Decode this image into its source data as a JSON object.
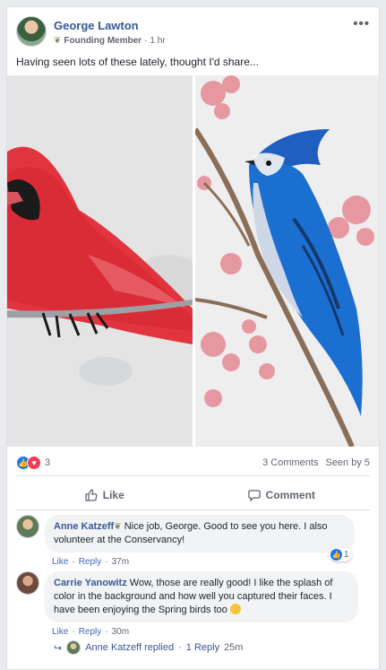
{
  "post": {
    "author": "George Lawton",
    "badge": "Founding Member",
    "time": "1 hr",
    "separator": "·",
    "text": "Having seen lots of these lately, thought I'd share...",
    "more_icon": "•••"
  },
  "reactions": {
    "count": "3",
    "comments": "3 Comments",
    "seen": "Seen by 5"
  },
  "actions": {
    "like_label": "Like",
    "comment_label": "Comment"
  },
  "comments": [
    {
      "name": "Anne Katzeff",
      "text": "Nice job, George. Good to see you here. I also volunteer at the Conservancy!",
      "like": "Like",
      "reply": "Reply",
      "time": "37m",
      "likes": "1"
    },
    {
      "name": "Carrie Yanowitz",
      "text": "Wow, those are really good! I like the splash of color in the background and how well you captured their faces. I have been enjoying the Spring birds too",
      "like": "Like",
      "reply": "Reply",
      "time": "30m"
    }
  ],
  "reply_summary": {
    "name": "Anne Katzeff replied",
    "count": "1 Reply",
    "time": "25m"
  },
  "colors": {
    "link": "#385898",
    "like": "#1877f2",
    "love": "#f33e58",
    "cardinal": "#e0303a",
    "bluejay": "#1b6fd1"
  }
}
